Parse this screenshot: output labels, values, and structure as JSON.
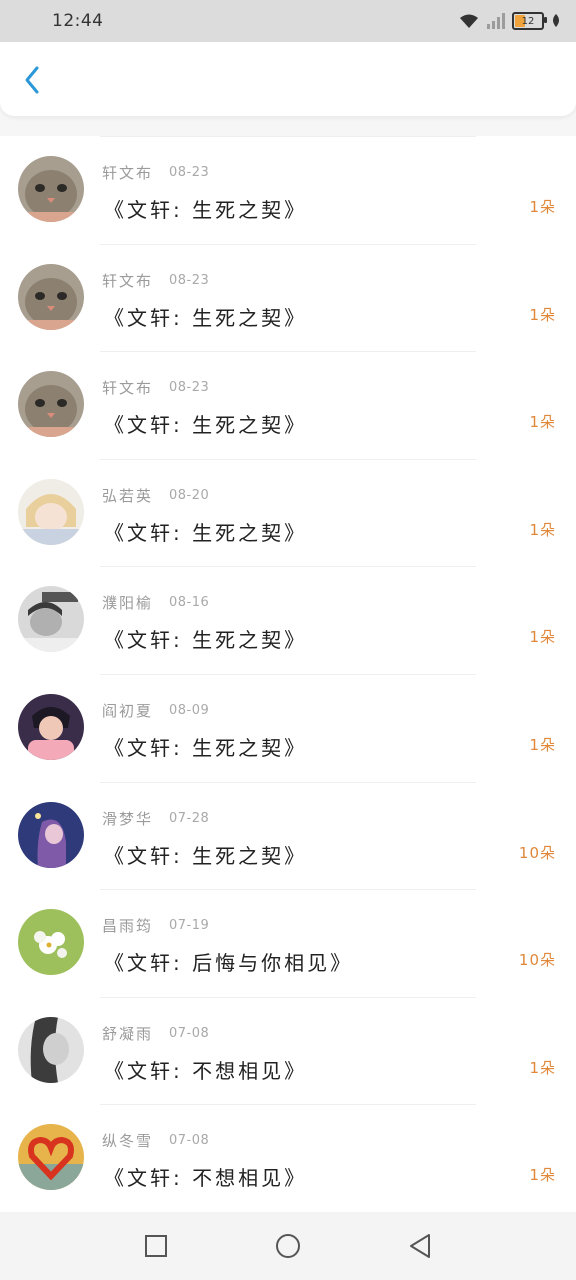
{
  "status_bar": {
    "time": "12:44",
    "battery": "12",
    "icons": [
      "wifi-icon",
      "signal-icon",
      "battery-icon",
      "leaf-icon"
    ]
  },
  "header": {
    "back_icon": "chevron-left-icon",
    "accent": "#2b97d6"
  },
  "colors": {
    "amount": "#e0873a",
    "name": "#9b9b9b"
  },
  "items": [
    {
      "name": "轩文布",
      "date": "08-23",
      "title": "《文轩:  生死之契》",
      "amount": "1朵",
      "avatar": "cat"
    },
    {
      "name": "轩文布",
      "date": "08-23",
      "title": "《文轩:  生死之契》",
      "amount": "1朵",
      "avatar": "cat"
    },
    {
      "name": "轩文布",
      "date": "08-23",
      "title": "《文轩:  生死之契》",
      "amount": "1朵",
      "avatar": "cat"
    },
    {
      "name": "弘若英",
      "date": "08-20",
      "title": "《文轩:  生死之契》",
      "amount": "1朵",
      "avatar": "anime"
    },
    {
      "name": "濮阳榆",
      "date": "08-16",
      "title": "《文轩:  生死之契》",
      "amount": "1朵",
      "avatar": "bw"
    },
    {
      "name": "阎初夏",
      "date": "08-09",
      "title": "《文轩:  生死之契》",
      "amount": "1朵",
      "avatar": "pink"
    },
    {
      "name": "滑梦华",
      "date": "07-28",
      "title": "《文轩:  生死之契》",
      "amount": "10朵",
      "avatar": "purple"
    },
    {
      "name": "昌雨筠",
      "date": "07-19",
      "title": "《文轩:  后悔与你相见》",
      "amount": "10朵",
      "avatar": "flower"
    },
    {
      "name": "舒凝雨",
      "date": "07-08",
      "title": "《文轩:  不想相见》",
      "amount": "1朵",
      "avatar": "gray"
    },
    {
      "name": "纵冬雪",
      "date": "07-08",
      "title": "《文轩:  不想相见》",
      "amount": "1朵",
      "avatar": "heart"
    }
  ],
  "nav": {
    "recent": "square-icon",
    "home": "circle-icon",
    "back": "triangle-back-icon"
  }
}
